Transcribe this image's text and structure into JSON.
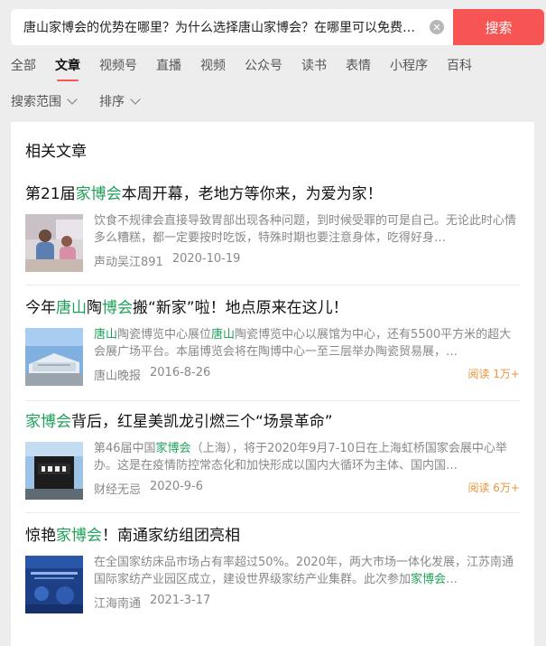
{
  "search": {
    "query": "唐山家博会的优势在哪里？为什么选择唐山家博会？在哪里可以免费…",
    "button_label": "搜索"
  },
  "tabs": [
    {
      "label": "全部",
      "active": false
    },
    {
      "label": "文章",
      "active": true
    },
    {
      "label": "视频号",
      "active": false
    },
    {
      "label": "直播",
      "active": false
    },
    {
      "label": "视频",
      "active": false
    },
    {
      "label": "公众号",
      "active": false
    },
    {
      "label": "读书",
      "active": false
    },
    {
      "label": "表情",
      "active": false
    },
    {
      "label": "小程序",
      "active": false
    },
    {
      "label": "百科",
      "active": false
    }
  ],
  "filters": {
    "scope_label": "搜索范围",
    "sort_label": "排序"
  },
  "section_title": "相关文章",
  "articles": [
    {
      "title_parts": [
        "第21届",
        "家博会",
        "本周开幕，老地方等你来，为爱为家！"
      ],
      "snippet_parts": [
        "饮食不规律会直接导致胃部出现各种问题，到时候受罪的可是自己。无论此时心情多么糟糕，都一定要按时吃饭，特殊时期也要注意身体，吃得好身…"
      ],
      "source": "声动吴江891",
      "date": "2020-10-19",
      "reads": ""
    },
    {
      "title_parts": [
        "今年",
        "唐山",
        "陶",
        "博会",
        "搬“新家”啦！地点原来在这儿！"
      ],
      "snippet_parts": [
        "唐山",
        "陶瓷博览中心展位",
        "唐山",
        "陶瓷博览中心以展馆为中心，还有5500平方米的超大会展广场平台。本届博览会将在陶博中心一至三层举办陶瓷贸易展，…"
      ],
      "source": "唐山晚报",
      "date": "2016-8-26",
      "reads": "阅读 1万+"
    },
    {
      "title_parts": [
        "家博会",
        "背后，红星美凯龙引燃三个“场景革命”"
      ],
      "snippet_parts": [
        "第46届中国",
        "家博会",
        "（上海），将于2020年9月7-10日在上海虹桥国家会展中心举办。这是在疫情防控常态化和加快形成以国内大循环为主体、国内国…"
      ],
      "source": "财经无忌",
      "date": "2020-9-6",
      "reads": "阅读 6万+"
    },
    {
      "title_parts": [
        "惊艳",
        "家博会",
        "！南通家纺组团亮相"
      ],
      "snippet_parts": [
        "在全国家纺床品市场占有率超过50%。2020年，两大市场一体化发展，江苏南通国际家纺产业园区成立，建设世界级家纺产业集群。此次参加",
        "家博会",
        "…"
      ],
      "source": "江海南通",
      "date": "2021-3-17",
      "reads": ""
    }
  ],
  "colors": {
    "accent": "#f75454",
    "highlight": "#1fa15a",
    "reads": "#e8953a"
  }
}
